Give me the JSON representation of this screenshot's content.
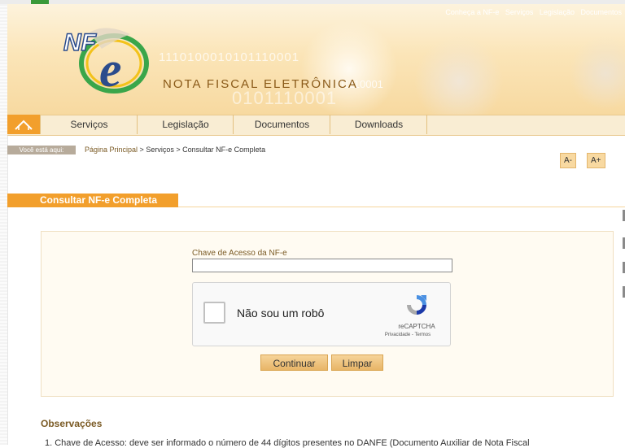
{
  "top_links": [
    "Conheça a NF-e",
    "Serviços",
    "Legislação",
    "Documentos"
  ],
  "banner": {
    "title": "NOTA FISCAL ELETRÔNICA",
    "binary_1": "1110100010101110001",
    "binary_2": "0101110001",
    "binary_3": "01110001",
    "logo_text": "NF e"
  },
  "nav": {
    "home_icon": "home-icon",
    "items": [
      "Serviços",
      "Legislação",
      "Documentos",
      "Downloads"
    ]
  },
  "breadcrumb": {
    "label": "Você está aqui:",
    "home": "Página Principal",
    "sep": " > ",
    "section": "Serviços",
    "current": "Consultar NF-e Completa"
  },
  "font_controls": {
    "decrease": "A-",
    "increase": "A+"
  },
  "page_title": "Consultar NF-e Completa",
  "form": {
    "key_label": "Chave de Acesso da NF-e",
    "key_value": "",
    "recaptcha_label": "Não sou um robô",
    "recaptcha_brand": "reCAPTCHA",
    "recaptcha_links": "Privacidade - Termos",
    "continue_label": "Continuar",
    "clear_label": "Limpar"
  },
  "notes": {
    "title": "Observações",
    "item_1": "1. Chave de Acesso: deve ser informado o número de 44 dígitos presentes no DANFE (Documento Auxiliar de Nota Fiscal"
  },
  "colors": {
    "accent": "#f29f2c",
    "link": "#7a5a24",
    "panel_bg": "#fffbf2"
  }
}
